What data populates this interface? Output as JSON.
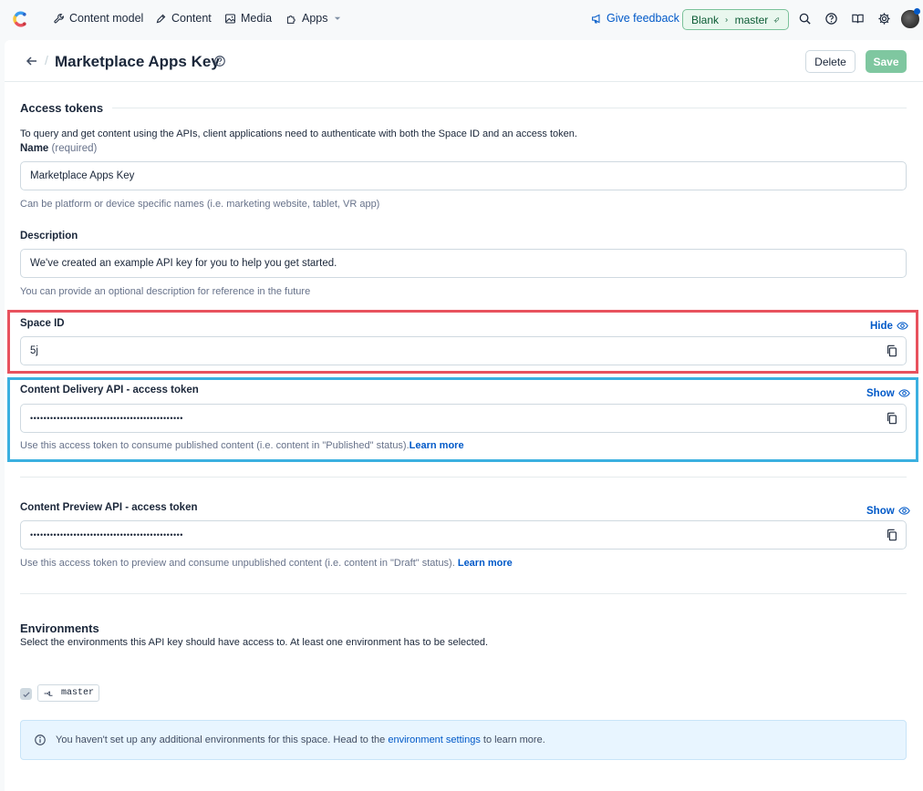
{
  "nav": {
    "items": [
      {
        "label": "Content model",
        "icon": "wrench-icon"
      },
      {
        "label": "Content",
        "icon": "pen-icon"
      },
      {
        "label": "Media",
        "icon": "image-icon"
      },
      {
        "label": "Apps",
        "icon": "puzzle-icon"
      }
    ],
    "feedback_label": "Give feedback",
    "space_name": "Blank",
    "environment": "master"
  },
  "header": {
    "title": "Marketplace Apps Key",
    "delete_label": "Delete",
    "save_label": "Save"
  },
  "access_tokens": {
    "heading": "Access tokens",
    "intro": "To query and get content using the APIs, client applications need to authenticate with both the Space ID and an access token."
  },
  "name_field": {
    "label": "Name",
    "required": "(required)",
    "value": "Marketplace Apps Key",
    "hint": "Can be platform or device specific names (i.e. marketing website, tablet, VR app)"
  },
  "description_field": {
    "label": "Description",
    "value": "We've created an example API key for you to help you get started.",
    "hint": "You can provide an optional description for reference in the future"
  },
  "space_id": {
    "label": "Space ID",
    "toggle": "Hide",
    "value": "5j"
  },
  "cda_token": {
    "label": "Content Delivery API - access token",
    "toggle": "Show",
    "value": "••••••••••••••••••••••••••••••••••••••••••••••",
    "hint": "Use this access token to consume published content (i.e. content in \"Published\" status).",
    "learn_more": "Learn more"
  },
  "cpa_token": {
    "label": "Content Preview API - access token",
    "toggle": "Show",
    "value": "••••••••••••••••••••••••••••••••••••••••••••••",
    "hint": "Use this access token to preview and consume unpublished content (i.e. content in \"Draft\" status).",
    "learn_more": "Learn more"
  },
  "environments": {
    "heading": "Environments",
    "intro": "Select the environments this API key should have access to. At least one environment has to be selected.",
    "items": [
      {
        "name": "master",
        "checked": true
      }
    ],
    "notice_prefix": "You haven't set up any additional environments for this space. Head to the",
    "notice_link": "environment settings",
    "notice_suffix": "to learn more."
  },
  "colors": {
    "brand_blue": "#0059c8",
    "highlight_red": "#e8525e",
    "highlight_blue": "#3bb0e0",
    "save_green": "#7fc7a0"
  }
}
